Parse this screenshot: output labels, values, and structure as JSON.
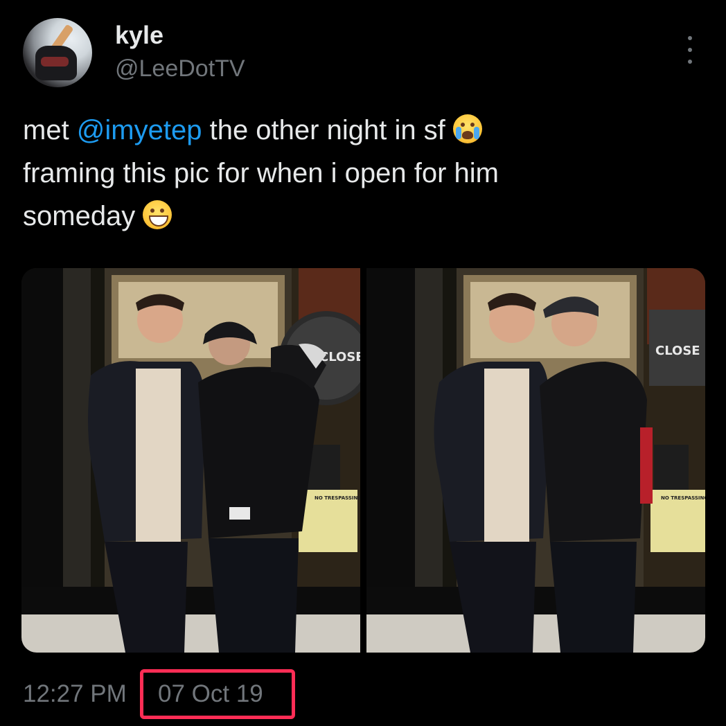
{
  "author": {
    "display_name": "kyle",
    "handle": "@LeeDotTV",
    "avatar_icon": "profile-avatar"
  },
  "tweet": {
    "text_part1": "met ",
    "mention": "@imyetep",
    "text_part2": " the other night in sf ",
    "emoji1": "loudly-crying-face",
    "text_line2": "framing this pic for when i open for him",
    "text_line3": "someday ",
    "emoji2": "grinning-face-with-smiling-eyes"
  },
  "media": {
    "images": [
      {
        "sign_text": "CLOSE",
        "notice_text": "NO TRESPASSING"
      },
      {
        "sign_text": "CLOSE",
        "notice_text": "NO TRESPASSING"
      }
    ]
  },
  "meta": {
    "time": "12:27 PM",
    "date": "07 Oct 19",
    "highlight_color": "#ff2d55"
  },
  "colors": {
    "background": "#000000",
    "text_primary": "#e7e9ea",
    "text_secondary": "#71767b",
    "mention": "#1d9bf0"
  }
}
